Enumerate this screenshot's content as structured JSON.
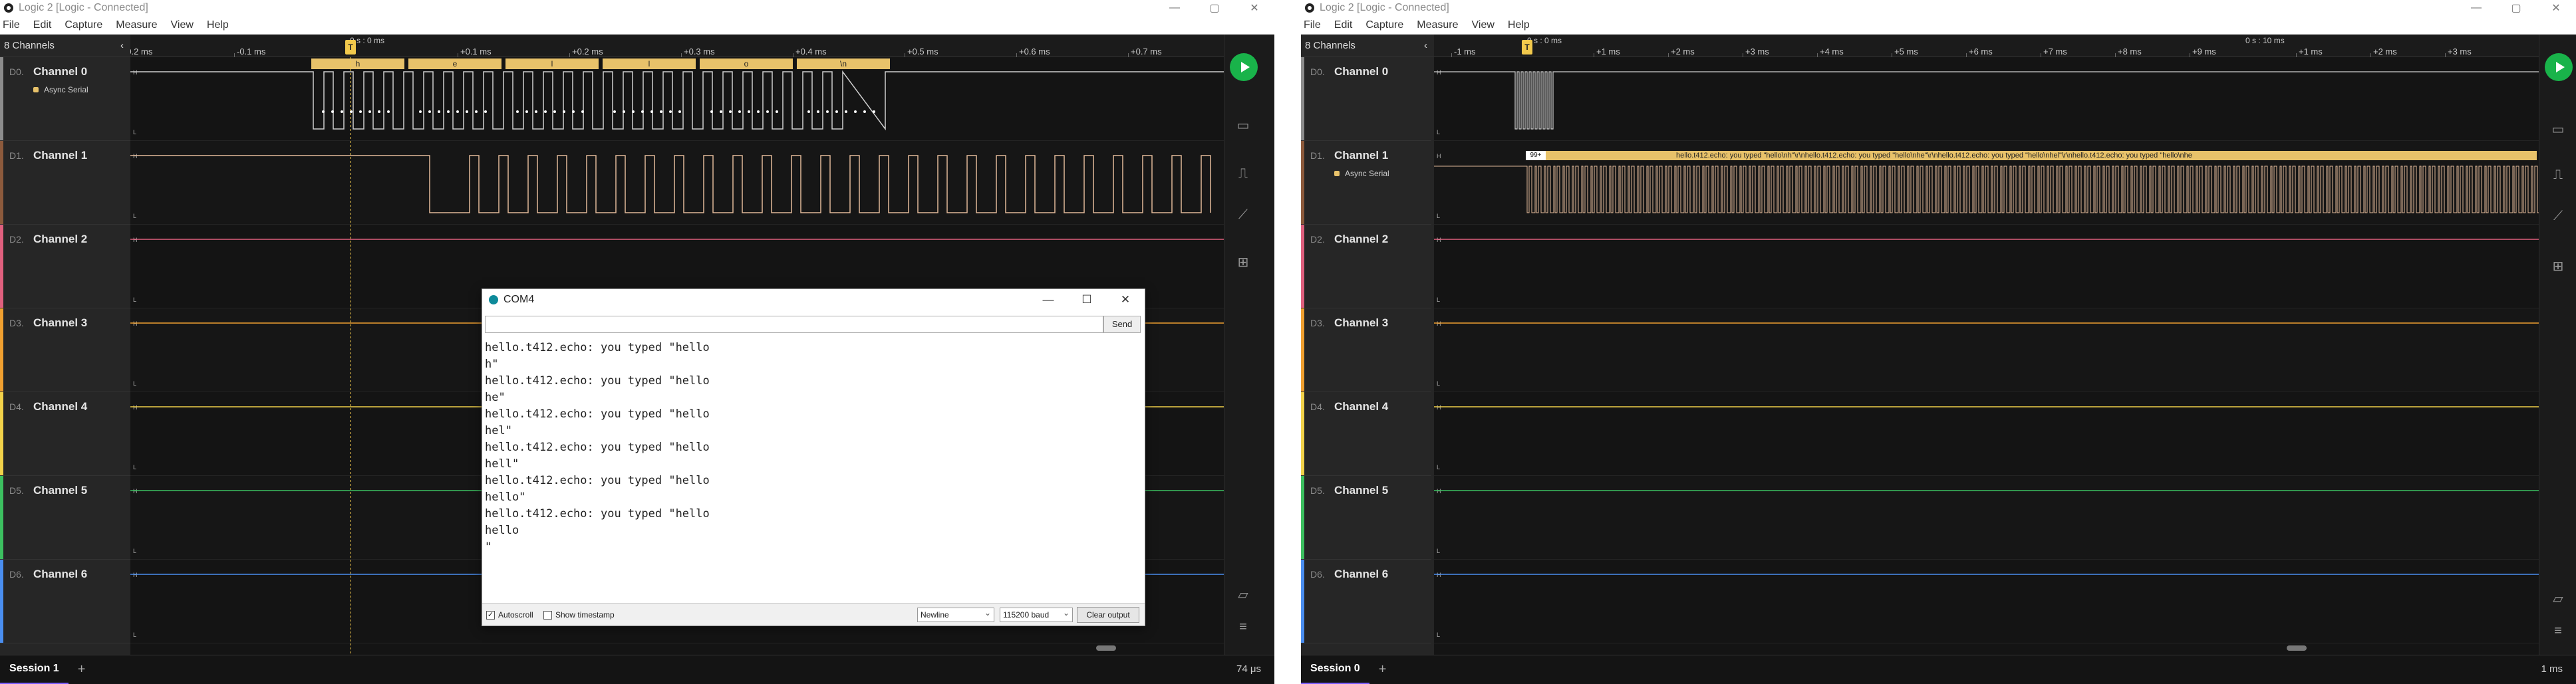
{
  "left": {
    "title": "Logic 2 [Logic - Connected]",
    "menu": [
      "File",
      "Edit",
      "Capture",
      "Measure",
      "View",
      "Help"
    ],
    "channel_count": "8 Channels",
    "channels": [
      {
        "num": "D0.",
        "name": "Channel 0",
        "analyzer": "Async Serial",
        "color": "#8c8c8c"
      },
      {
        "num": "D1.",
        "name": "Channel 1",
        "analyzer": "",
        "color": "#8c5a3c"
      },
      {
        "num": "D2.",
        "name": "Channel 2",
        "analyzer": "",
        "color": "#e0607e"
      },
      {
        "num": "D3.",
        "name": "Channel 3",
        "analyzer": "",
        "color": "#f0a030"
      },
      {
        "num": "D4.",
        "name": "Channel 4",
        "analyzer": "",
        "color": "#f2d24a"
      },
      {
        "num": "D5.",
        "name": "Channel 5",
        "analyzer": "",
        "color": "#3cc060"
      },
      {
        "num": "D6.",
        "name": "Channel 6",
        "analyzer": "",
        "color": "#4a8ef0"
      }
    ],
    "ruler": [
      "-0.2 ms",
      "-0.1 ms",
      "+0.1 ms",
      "+0.2 ms",
      "+0.3 ms",
      "+0.4 ms",
      "+0.5 ms",
      "+0.6 ms",
      "+0.7 ms"
    ],
    "marker": {
      "flag": "T",
      "label": "0 s : 0 ms"
    },
    "decoded": [
      "h",
      "e",
      "l",
      "l",
      "o",
      "\\n"
    ],
    "session": "Session 1",
    "zoom": "74 μs"
  },
  "right": {
    "title": "Logic 2 [Logic - Connected]",
    "menu": [
      "File",
      "Edit",
      "Capture",
      "Measure",
      "View",
      "Help"
    ],
    "channel_count": "8 Channels",
    "channels": [
      {
        "num": "D0.",
        "name": "Channel 0",
        "analyzer": "",
        "color": "#8c8c8c"
      },
      {
        "num": "D1.",
        "name": "Channel 1",
        "analyzer": "Async Serial",
        "color": "#8c5a3c"
      },
      {
        "num": "D2.",
        "name": "Channel 2",
        "analyzer": "",
        "color": "#e0607e"
      },
      {
        "num": "D3.",
        "name": "Channel 3",
        "analyzer": "",
        "color": "#f0a030"
      },
      {
        "num": "D4.",
        "name": "Channel 4",
        "analyzer": "",
        "color": "#f2d24a"
      },
      {
        "num": "D5.",
        "name": "Channel 5",
        "analyzer": "",
        "color": "#3cc060"
      },
      {
        "num": "D6.",
        "name": "Channel 6",
        "analyzer": "",
        "color": "#4a8ef0"
      }
    ],
    "ruler": [
      "-1 ms",
      "+1 ms",
      "+2 ms",
      "+3 ms",
      "+4 ms",
      "+5 ms",
      "+6 ms",
      "+7 ms",
      "+8 ms",
      "+9 ms",
      "+1 ms",
      "+2 ms",
      "+3 ms"
    ],
    "ruler_secondary": "0 s : 10 ms",
    "marker": {
      "flag": "T",
      "label": "0 s : 0 ms"
    },
    "decoded_badge": "99+",
    "decoded_text": "hello.t412.echo: you typed \"hello\\nh\"\\r\\nhello.t412.echo: you typed \"hello\\nhe\"\\r\\nhello.t412.echo: you typed \"hello\\nhel\"\\r\\nhello.t412.echo: you typed \"hello\\nhe",
    "session": "Session 0",
    "zoom": "1 ms"
  },
  "serial": {
    "title": "COM4",
    "send_label": "Send",
    "send_value": "",
    "output": "hello.t412.echo: you typed \"hello\nh\"\nhello.t412.echo: you typed \"hello\nhe\"\nhello.t412.echo: you typed \"hello\nhel\"\nhello.t412.echo: you typed \"hello\nhell\"\nhello.t412.echo: you typed \"hello\nhello\"\nhello.t412.echo: you typed \"hello\nhello\n\"",
    "autoscroll_label": "Autoscroll",
    "autoscroll_checked": true,
    "timestamp_label": "Show timestamp",
    "timestamp_checked": false,
    "line_ending": "Newline",
    "baud": "115200 baud",
    "clear_label": "Clear output"
  },
  "icons": {
    "play": "play-icon",
    "device": "device-icon",
    "analyzers": "analyzers-icon",
    "measure": "measure-icon",
    "extensions": "extensions-icon",
    "notes": "notes-icon",
    "menu": "menu-icon"
  },
  "colors": {
    "background": "#141414",
    "decode_bubble": "#e8c26a",
    "play": "#19b34a"
  }
}
